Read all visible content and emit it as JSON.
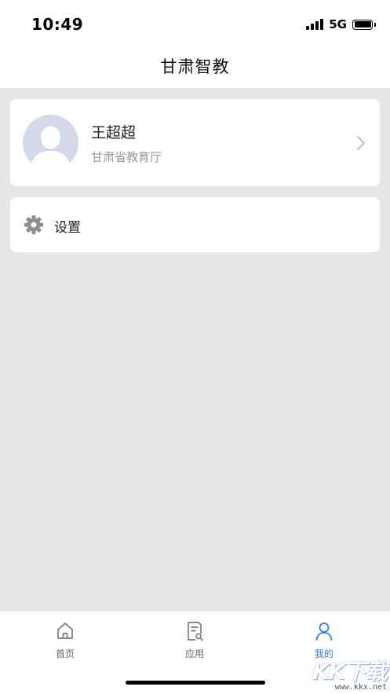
{
  "status_bar": {
    "time": "10:49",
    "network": "5G",
    "icons": [
      "signal-icon",
      "battery-icon"
    ]
  },
  "nav": {
    "title": "甘肃智教"
  },
  "profile": {
    "name": "王超超",
    "organization": "甘肃省教育厅",
    "avatar_icon": "default-avatar-icon",
    "chevron_icon": "chevron-right-icon"
  },
  "settings": {
    "label": "设置",
    "icon": "gear-icon"
  },
  "tab_bar": {
    "active_color": "#2f7cf6",
    "items": [
      {
        "label": "首页",
        "icon": "home-icon"
      },
      {
        "label": "应用",
        "icon": "document-search-icon"
      },
      {
        "label": "我的",
        "icon": "person-icon"
      }
    ]
  },
  "watermark": {
    "logo": "KK下载",
    "url": "www.kkx.net"
  }
}
